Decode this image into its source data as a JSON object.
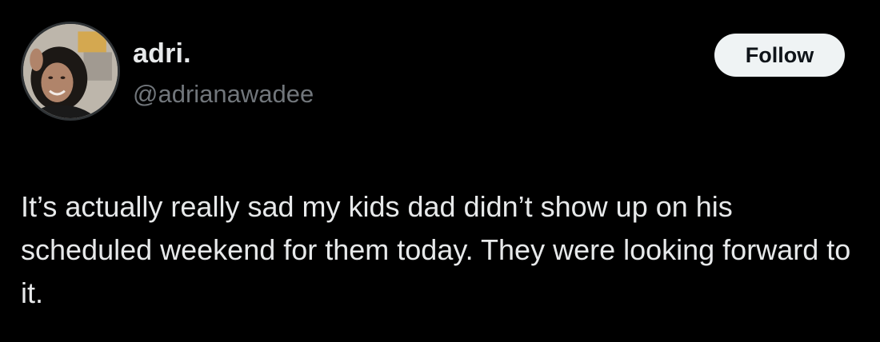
{
  "author": {
    "display_name": "adri.",
    "handle": "@adrianawadee",
    "avatar_icon": "profile-photo"
  },
  "actions": {
    "follow_label": "Follow"
  },
  "tweet": {
    "text": "It’s actually really sad my kids dad didn’t show up on his scheduled weekend for them today. They were looking forward to it."
  },
  "colors": {
    "background": "#000000",
    "primary_text": "#e7e9ea",
    "secondary_text": "#71767b",
    "follow_button_bg": "#eff3f4",
    "follow_button_text": "#0f1419"
  }
}
